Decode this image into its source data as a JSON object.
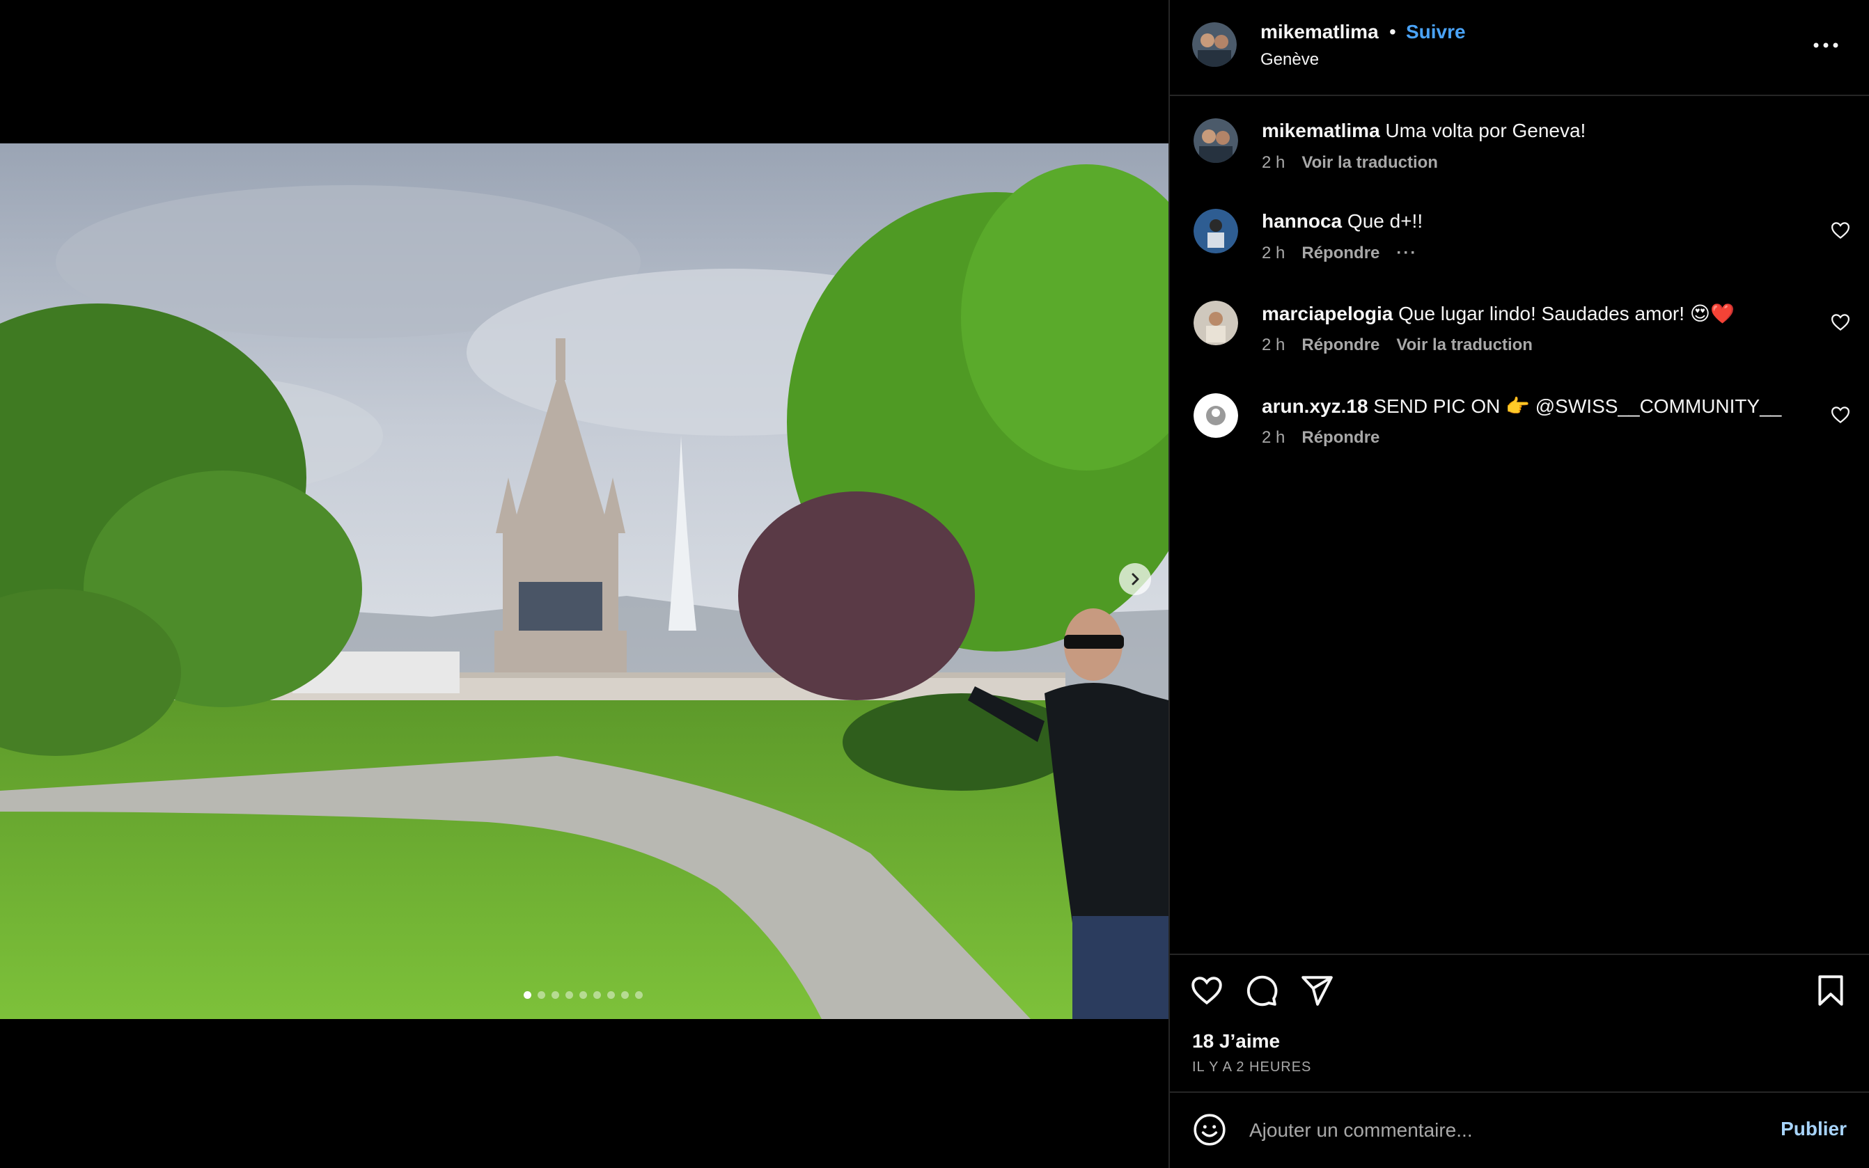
{
  "post": {
    "username": "mikematlima",
    "separator": "•",
    "follow_label": "Suivre",
    "location": "Genève",
    "options_icon": "more-horizontal-icon"
  },
  "carousel": {
    "slide_count": 9,
    "active_index": 0,
    "next_icon": "chevron-right-icon"
  },
  "caption": {
    "username": "mikematlima",
    "text": "Uma volta por Geneva!",
    "time": "2 h",
    "translate_label": "Voir la traduction"
  },
  "comments": [
    {
      "username": "hannoca",
      "text": "Que d+!!",
      "time": "2 h",
      "reply_label": "Répondre",
      "more_label": "···"
    },
    {
      "username": "marciapelogia",
      "text": "Que lugar lindo! Saudades amor! 😍❤️",
      "time": "2 h",
      "reply_label": "Répondre",
      "translate_label": "Voir la traduction"
    },
    {
      "username": "arun.xyz.18",
      "text": "SEND PIC ON 👉 @SWISS__COMMUNITY__",
      "time": "2 h",
      "reply_label": "Répondre"
    }
  ],
  "stats": {
    "likes": "18 J’aime",
    "posted": "IL Y A 2 HEURES"
  },
  "comment_box": {
    "placeholder": "Ajouter un commentaire...",
    "publish_label": "Publier"
  },
  "colors": {
    "accent": "#4aa3f7",
    "publish_disabled": "#a8d4fb",
    "secondary_text": "#a8a8a8",
    "divider": "#262626"
  },
  "icons": [
    "heart-icon",
    "comment-icon",
    "share-icon",
    "bookmark-icon",
    "emoji-icon"
  ]
}
